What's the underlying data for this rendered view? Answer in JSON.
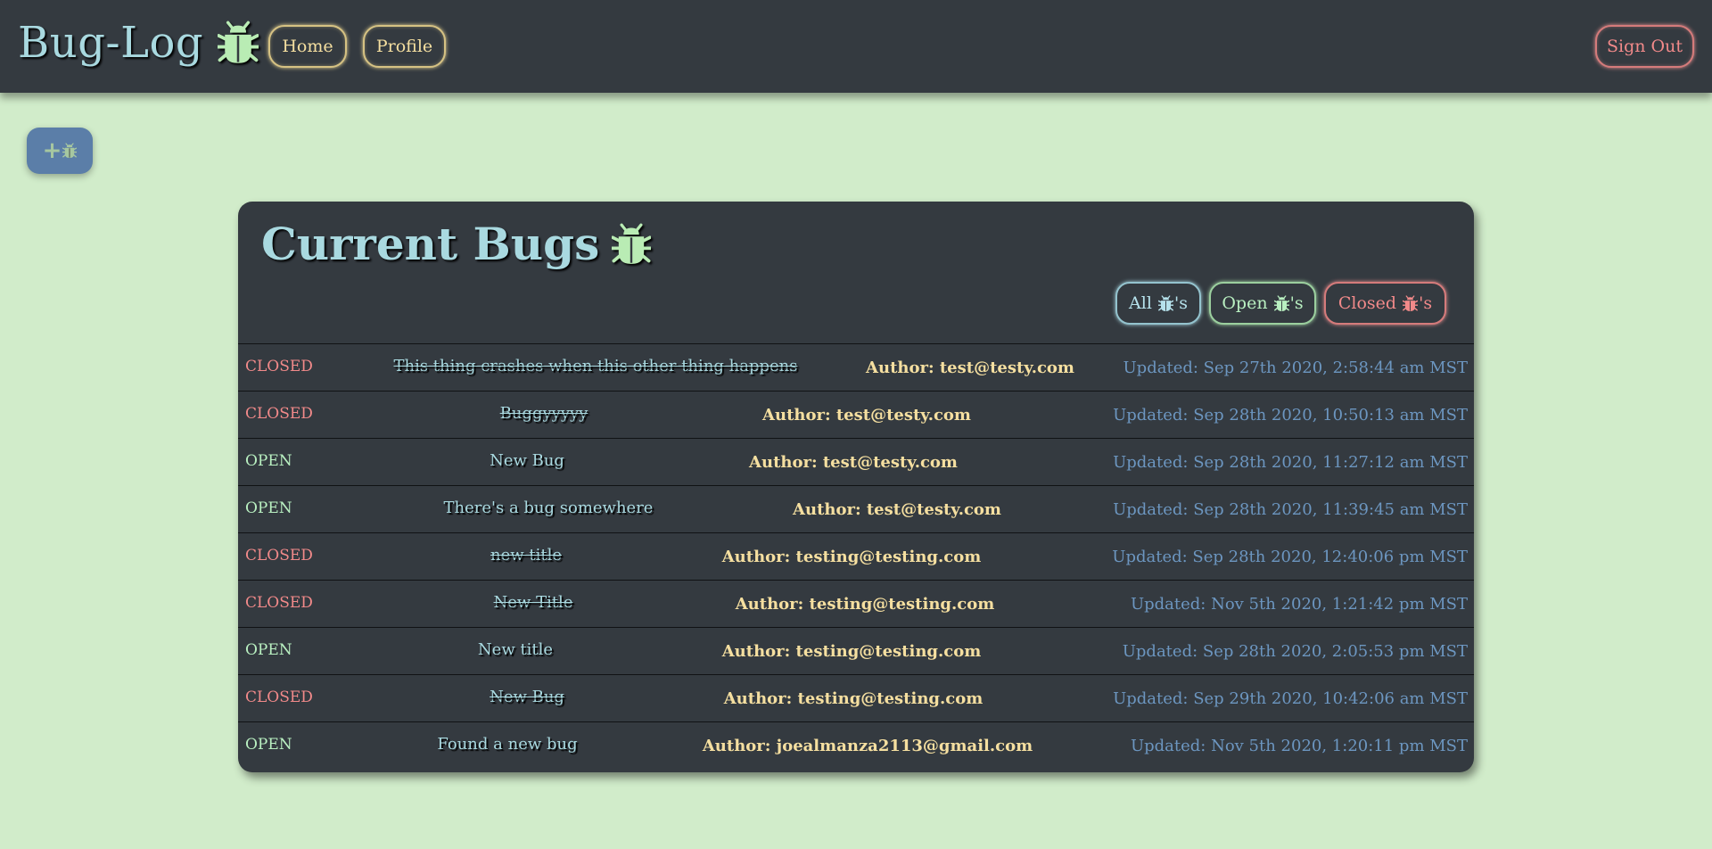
{
  "header": {
    "brand": "Bug-Log",
    "brand_icon": "bug-icon",
    "nav": {
      "home": "Home",
      "profile": "Profile",
      "sign_out": "Sign Out"
    }
  },
  "add_button": {
    "plus": "+",
    "icon": "bug-icon"
  },
  "card": {
    "title": "Current Bugs",
    "filters": {
      "all_prefix": "All ",
      "open_prefix": "Open ",
      "closed_prefix": "Closed ",
      "suffix": "'s"
    },
    "bugs": [
      {
        "status": "CLOSED",
        "title": "This thing crashes when this other thing happens",
        "author": "Author: test@testy.com",
        "updated": "Updated: Sep 27th 2020, 2:58:44 am MST"
      },
      {
        "status": "CLOSED",
        "title": "Buggyyyyy",
        "author": "Author: test@testy.com",
        "updated": "Updated: Sep 28th 2020, 10:50:13 am MST"
      },
      {
        "status": "OPEN",
        "title": "New Bug",
        "author": "Author: test@testy.com",
        "updated": "Updated: Sep 28th 2020, 11:27:12 am MST"
      },
      {
        "status": "OPEN",
        "title": "There's a bug somewhere",
        "author": "Author: test@testy.com",
        "updated": "Updated: Sep 28th 2020, 11:39:45 am MST"
      },
      {
        "status": "CLOSED",
        "title": "new title",
        "author": "Author: testing@testing.com",
        "updated": "Updated: Sep 28th 2020, 12:40:06 pm MST"
      },
      {
        "status": "CLOSED",
        "title": "New Title",
        "author": "Author: testing@testing.com",
        "updated": "Updated: Nov 5th 2020, 1:21:42 pm MST"
      },
      {
        "status": "OPEN",
        "title": "New title",
        "author": "Author: testing@testing.com",
        "updated": "Updated: Sep 28th 2020, 2:05:53 pm MST"
      },
      {
        "status": "CLOSED",
        "title": "New Bug",
        "author": "Author: testing@testing.com",
        "updated": "Updated: Sep 29th 2020, 10:42:06 am MST"
      },
      {
        "status": "OPEN",
        "title": "Found a new bug",
        "author": "Author: joealmanza2113@gmail.com",
        "updated": "Updated: Nov 5th 2020, 1:20:11 pm MST"
      }
    ]
  },
  "colors": {
    "page_bg": "#d1ecca",
    "panel_bg": "#343a40",
    "closed": "#f28a8a",
    "open": "#b9f0c1",
    "title": "#a9d9e0",
    "author": "#f5dfa0",
    "updated": "#6c96c0",
    "bug_icon_green": "#b9ecb4",
    "bug_icon_dark": "#2c5a70"
  }
}
